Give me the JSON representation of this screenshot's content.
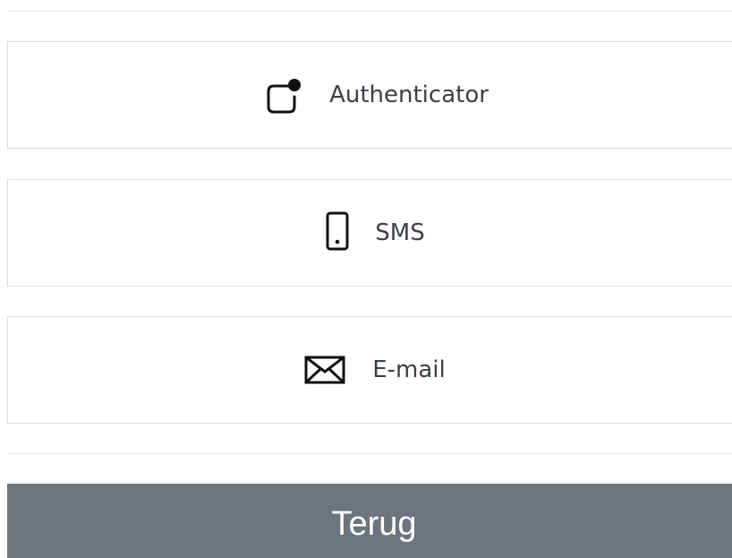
{
  "methods": [
    {
      "label": "Authenticator",
      "icon": "authenticator-icon"
    },
    {
      "label": "SMS",
      "icon": "phone-icon"
    },
    {
      "label": "E-mail",
      "icon": "envelope-icon"
    }
  ],
  "back_button": {
    "label": "Terug",
    "color": "#6c757d"
  },
  "colors": {
    "border": "#dcdcdc",
    "text": "#3c4048",
    "divider": "#e6e6e6"
  }
}
